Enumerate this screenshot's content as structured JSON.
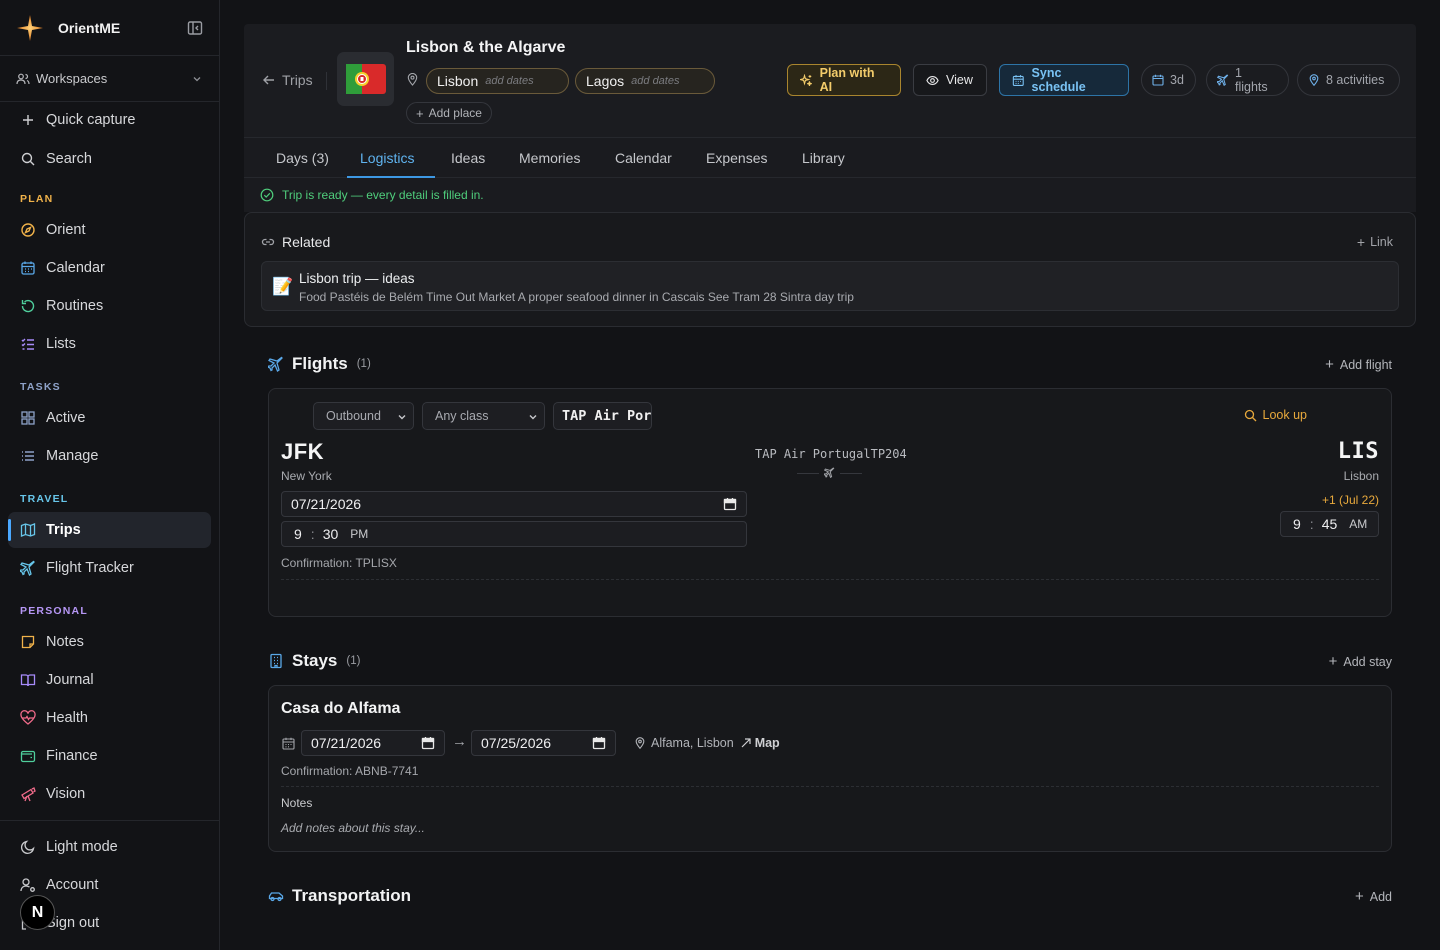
{
  "app": {
    "name": "OrientME"
  },
  "sidebar": {
    "workspaces_label": "Workspaces",
    "quick_capture": "Quick capture",
    "search": "Search",
    "sections": {
      "plan": "PLAN",
      "tasks": "TASKS",
      "travel": "TRAVEL",
      "personal": "PERSONAL"
    },
    "plan_items": [
      "Orient",
      "Calendar",
      "Routines",
      "Lists"
    ],
    "task_items": [
      "Active",
      "Manage"
    ],
    "travel_items": [
      "Trips",
      "Flight Tracker"
    ],
    "personal_items": [
      "Notes",
      "Journal",
      "Health",
      "Finance",
      "Vision"
    ],
    "bottom_items": [
      "Light mode",
      "Account",
      "Sign out"
    ],
    "active_item": "Trips",
    "avatar_letter": "N"
  },
  "trip": {
    "back_label": "Trips",
    "title": "Lisbon & the Algarve",
    "flag": "🇵🇹",
    "places": [
      {
        "name": "Lisbon",
        "dates_placeholder": "add dates"
      },
      {
        "name": "Lagos",
        "dates_placeholder": "add dates"
      }
    ],
    "add_place": "Add place",
    "buttons": {
      "plan_ai": "Plan with AI",
      "view": "View",
      "sync": "Sync schedule"
    },
    "pills": {
      "days": "3d",
      "flights": "1 flights",
      "activities": "8 activities"
    }
  },
  "tabs": [
    "Days (3)",
    "Logistics",
    "Ideas",
    "Memories",
    "Calendar",
    "Expenses",
    "Library"
  ],
  "active_tab": "Logistics",
  "status": {
    "text": "Trip is ready — every detail is filled in."
  },
  "related": {
    "title": "Related",
    "link_label": "Link",
    "items": [
      {
        "emoji": "📝",
        "title": "Lisbon trip — ideas",
        "snippet": "Food Pastéis de Belém Time Out Market A proper seafood dinner in Cascais See Tram 28 Sintra day trip"
      }
    ]
  },
  "flights": {
    "title": "Flights",
    "count": "(1)",
    "add_label": "Add flight",
    "items": [
      {
        "direction": "Outbound",
        "class": "Any class",
        "airline_input": "TAP Air Portugal",
        "lookup_label": "Look up",
        "from_code": "JFK",
        "from_city": "New York",
        "to_code": "LIS",
        "to_city": "Lisbon",
        "airline_flight": "TAP Air PortugalTP204",
        "depart_date": "07/21/2026",
        "depart_hour": "9",
        "depart_minute": "30",
        "depart_ampm": "PM",
        "arrive_offset": "+1 (Jul 22)",
        "arrive_hour": "9",
        "arrive_minute": "45",
        "arrive_ampm": "AM",
        "confirmation": "Confirmation: TPLISX"
      }
    ]
  },
  "stays": {
    "title": "Stays",
    "count": "(1)",
    "add_label": "Add stay",
    "items": [
      {
        "name": "Casa do Alfama",
        "check_in": "07/21/2026",
        "check_out": "07/25/2026",
        "location": "Alfama, Lisbon",
        "map_label": "Map",
        "confirmation": "Confirmation: ABNB-7741",
        "notes_label": "Notes",
        "notes_placeholder": "Add notes about this stay..."
      }
    ]
  },
  "transportation": {
    "title": "Transportation",
    "add_label": "Add"
  },
  "colors": {
    "accent_blue": "#5fb3ef",
    "accent_amber": "#e8a93c",
    "success_green": "#4fce7c",
    "background": "#121316"
  }
}
